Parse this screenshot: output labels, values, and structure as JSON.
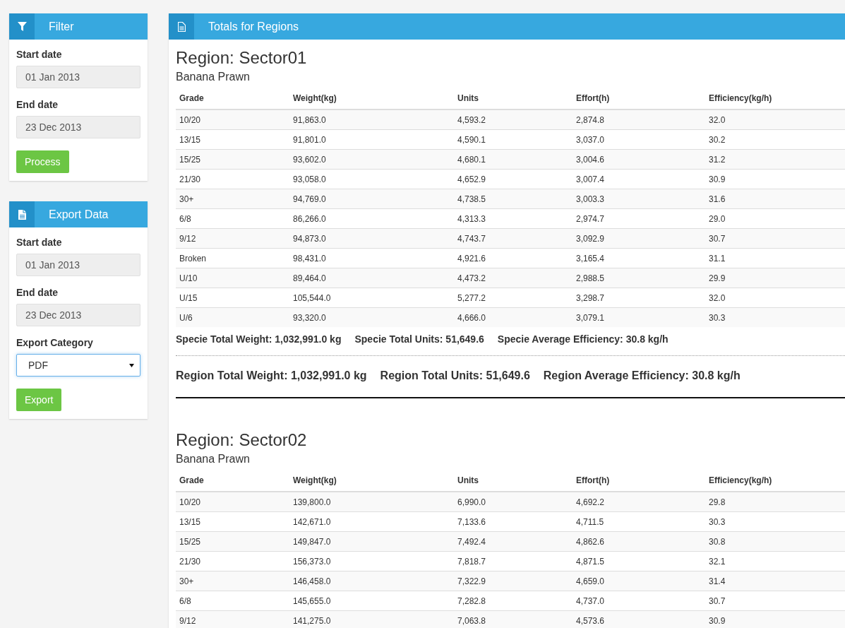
{
  "filter": {
    "title": "Filter",
    "fields": [
      {
        "label": "Start date",
        "value": "01 Jan 2013"
      },
      {
        "label": "End date",
        "value": "23 Dec 2013"
      }
    ],
    "button": "Process"
  },
  "export": {
    "title": "Export Data",
    "fields": [
      {
        "label": "Start date",
        "value": "01 Jan 2013"
      },
      {
        "label": "End date",
        "value": "23 Dec 2013"
      }
    ],
    "category": {
      "label": "Export Category",
      "value": "PDF"
    },
    "button": "Export"
  },
  "report": {
    "title": "Totals for Regions",
    "regions": [
      {
        "heading": "Region: Sector01",
        "species": "Banana Prawn",
        "columns": [
          "Grade",
          "Weight(kg)",
          "Units",
          "Effort(h)",
          "Efficiency(kg/h)"
        ],
        "rows": [
          [
            "10/20",
            "91,863.0",
            "4,593.2",
            "2,874.8",
            "32.0"
          ],
          [
            "13/15",
            "91,801.0",
            "4,590.1",
            "3,037.0",
            "30.2"
          ],
          [
            "15/25",
            "93,602.0",
            "4,680.1",
            "3,004.6",
            "31.2"
          ],
          [
            "21/30",
            "93,058.0",
            "4,652.9",
            "3,007.4",
            "30.9"
          ],
          [
            "30+",
            "94,769.0",
            "4,738.5",
            "3,003.3",
            "31.6"
          ],
          [
            "6/8",
            "86,266.0",
            "4,313.3",
            "2,974.7",
            "29.0"
          ],
          [
            "9/12",
            "94,873.0",
            "4,743.7",
            "3,092.9",
            "30.7"
          ],
          [
            "Broken",
            "98,431.0",
            "4,921.6",
            "3,165.4",
            "31.1"
          ],
          [
            "U/10",
            "89,464.0",
            "4,473.2",
            "2,988.5",
            "29.9"
          ],
          [
            "U/15",
            "105,544.0",
            "5,277.2",
            "3,298.7",
            "32.0"
          ],
          [
            "U/6",
            "93,320.0",
            "4,666.0",
            "3,079.1",
            "30.3"
          ]
        ],
        "species_totals": [
          "Specie Total Weight: 1,032,991.0 kg",
          "Specie Total Units: 51,649.6",
          "Specie Average Efficiency: 30.8 kg/h"
        ],
        "region_totals": [
          "Region Total Weight: 1,032,991.0 kg",
          "Region Total Units: 51,649.6",
          "Region Average Efficiency: 30.8 kg/h"
        ]
      },
      {
        "heading": "Region: Sector02",
        "species": "Banana Prawn",
        "columns": [
          "Grade",
          "Weight(kg)",
          "Units",
          "Effort(h)",
          "Efficiency(kg/h)"
        ],
        "rows": [
          [
            "10/20",
            "139,800.0",
            "6,990.0",
            "4,692.2",
            "29.8"
          ],
          [
            "13/15",
            "142,671.0",
            "7,133.6",
            "4,711.5",
            "30.3"
          ],
          [
            "15/25",
            "149,847.0",
            "7,492.4",
            "4,862.6",
            "30.8"
          ],
          [
            "21/30",
            "156,373.0",
            "7,818.7",
            "4,871.5",
            "32.1"
          ],
          [
            "30+",
            "146,458.0",
            "7,322.9",
            "4,659.0",
            "31.4"
          ],
          [
            "6/8",
            "145,655.0",
            "7,282.8",
            "4,737.0",
            "30.7"
          ],
          [
            "9/12",
            "141,275.0",
            "7,063.8",
            "4,573.6",
            "30.9"
          ]
        ]
      }
    ]
  }
}
